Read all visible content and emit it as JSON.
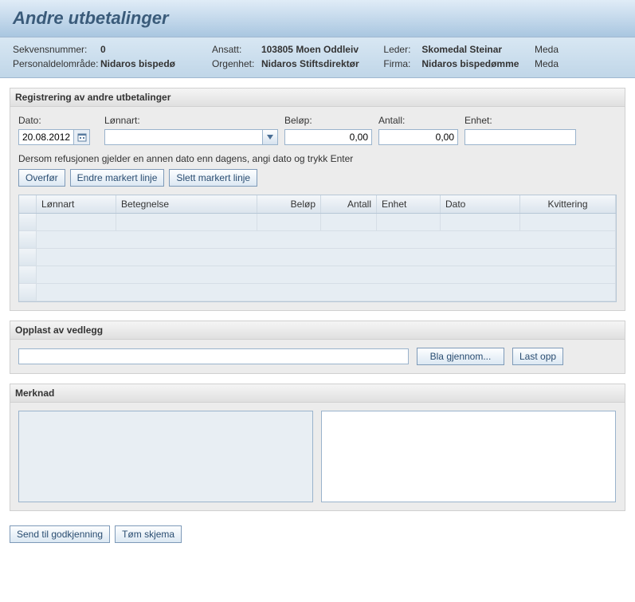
{
  "title": "Andre utbetalinger",
  "header": {
    "sekvensnummer_label": "Sekvensnummer:",
    "sekvensnummer_value": "0",
    "personaldelomrade_label": "Personaldelområde:",
    "personaldelomrade_value": "Nidaros bispedø",
    "ansatt_label": "Ansatt:",
    "ansatt_value": "103805 Moen Oddleiv",
    "orgenhet_label": "Orgenhet:",
    "orgenhet_value": "Nidaros Stiftsdirektør",
    "leder_label": "Leder:",
    "leder_value": "Skomedal Steinar",
    "firma_label": "Firma:",
    "firma_value": "Nidaros bispedømme",
    "meda1": "Meda",
    "meda2": "Meda"
  },
  "registrering": {
    "heading": "Registrering av andre utbetalinger",
    "dato_label": "Dato:",
    "dato_value": "20.08.2012",
    "lonnart_label": "Lønnart:",
    "lonnart_value": "",
    "belop_label": "Beløp:",
    "belop_value": "0,00",
    "antall_label": "Antall:",
    "antall_value": "0,00",
    "enhet_label": "Enhet:",
    "enhet_value": "",
    "hint": "Dersom refusjonen gjelder en annen dato enn dagens, angi dato og trykk Enter",
    "overfor_btn": "Overfør",
    "endre_btn": "Endre markert linje",
    "slett_btn": "Slett markert linje",
    "grid_headers": {
      "lonnart": "Lønnart",
      "betegnelse": "Betegnelse",
      "belop": "Beløp",
      "antall": "Antall",
      "enhet": "Enhet",
      "dato": "Dato",
      "kvittering": "Kvittering"
    }
  },
  "opplast": {
    "heading": "Opplast av vedlegg",
    "file_value": "",
    "browse_btn": "Bla gjennom...",
    "upload_btn": "Last opp"
  },
  "merknad": {
    "heading": "Merknad",
    "left_value": "",
    "right_value": ""
  },
  "footer": {
    "send_btn": "Send til godkjenning",
    "tom_btn": "Tøm skjema"
  }
}
